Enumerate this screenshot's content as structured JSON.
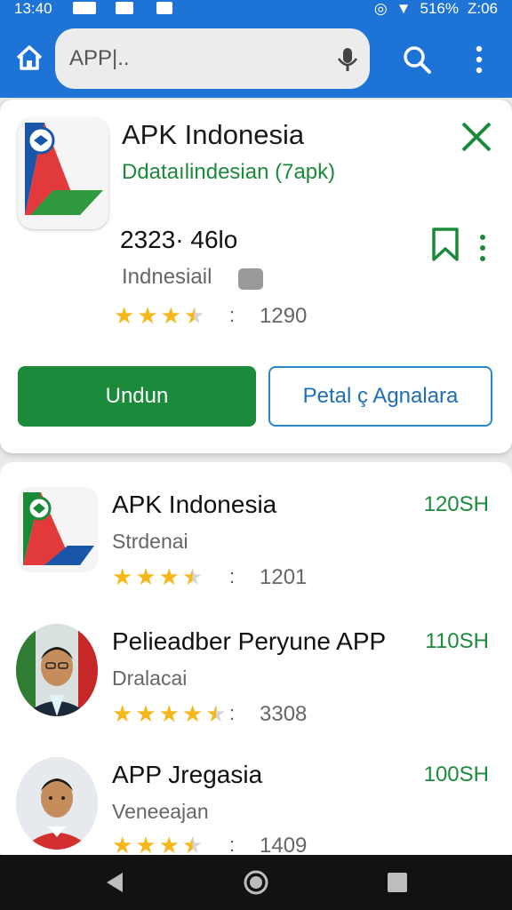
{
  "status_bar": {
    "time": "13:40",
    "battery": "516%",
    "clock": "Z:06"
  },
  "search": {
    "query": "APP",
    "cursor": "|.."
  },
  "featured": {
    "title": "APK Indonesia",
    "subtitle": "Ddataılindesian  (7apk)",
    "number": "2323· 46lo",
    "region": "Indnesiail",
    "rating": 3.5,
    "rating_count": "1290",
    "primary_button": "Undun",
    "secondary_button": "Petal ç Agnalara"
  },
  "results": [
    {
      "title": "APK Indonesia",
      "subtitle": "Strdenai",
      "size": "120SH",
      "rating": 3.5,
      "count": "1201",
      "icon": "apk-indonesia-icon"
    },
    {
      "title": "Pelieadber Peryune APP",
      "subtitle": "Dralacai",
      "size": "110SH",
      "rating": 4.5,
      "count": "3308",
      "icon": "developer-avatar"
    },
    {
      "title": "APP Jregasia",
      "subtitle": "Veneeajan",
      "size": "100SH",
      "rating": 3.5,
      "count": "1409",
      "icon": "developer-avatar"
    }
  ],
  "colors": {
    "accent_blue": "#1e74d6",
    "accent_green": "#1b8a3a",
    "star": "#f5b71a"
  }
}
